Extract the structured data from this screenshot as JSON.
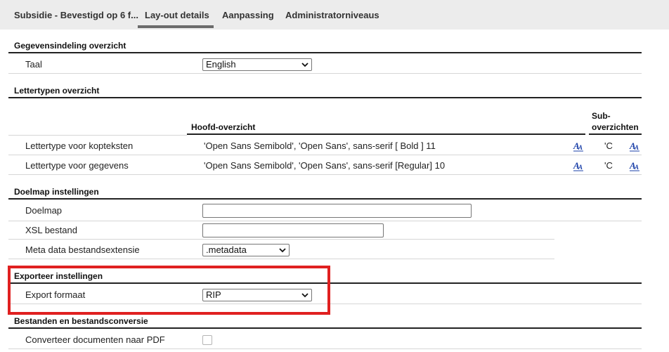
{
  "tabs": [
    {
      "label": "Subsidie - Bevestigd op 6 f..."
    },
    {
      "label": "Lay-out details"
    },
    {
      "label": "Aanpassing"
    },
    {
      "label": "Administratorniveaus"
    }
  ],
  "data_layout": {
    "title": "Gegevensindeling overzicht",
    "language_label": "Taal",
    "language_value": "English"
  },
  "fonts": {
    "title": "Lettertypen overzicht",
    "col_main": "Hoofd-overzicht",
    "col_sub_line1": "Sub-",
    "col_sub_line2": "overzichten",
    "rows": [
      {
        "label": "Lettertype voor kopteksten",
        "main_value": "'Open Sans Semibold', 'Open Sans', sans-serif [ Bold ] 11",
        "sub_value": "'C"
      },
      {
        "label": "Lettertype voor gegevens",
        "main_value": "'Open Sans Semibold', 'Open Sans', sans-serif [Regular] 10",
        "sub_value": "'C"
      }
    ],
    "icon_glyph": "A"
  },
  "target": {
    "title": "Doelmap instellingen",
    "folder_label": "Doelmap",
    "folder_value": "",
    "xsl_label": "XSL bestand",
    "xsl_value": "",
    "meta_label": "Meta data bestandsextensie",
    "meta_value": ".metadata"
  },
  "export": {
    "title": "Exporteer instellingen",
    "format_label": "Export formaat",
    "format_value": "RIP"
  },
  "files": {
    "title": "Bestanden en bestandsconversie",
    "pdf_label": "Converteer documenten naar PDF",
    "pdf_checked": false
  },
  "colors": {
    "highlight": "#e02020",
    "icon_blue": "#1a3fa8"
  }
}
